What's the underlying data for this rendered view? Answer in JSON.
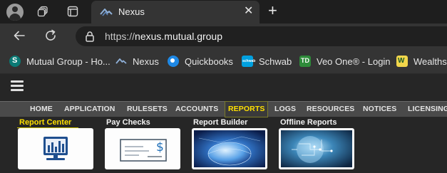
{
  "browser": {
    "active_tab": {
      "title": "Nexus"
    },
    "address": {
      "scheme": "https://",
      "host": "nexus.mutual.group"
    }
  },
  "bookmarks": [
    {
      "label": "Mutual Group - Ho...",
      "icon": "sharepoint-icon"
    },
    {
      "label": "Nexus",
      "icon": "nexus-icon"
    },
    {
      "label": "Quickbooks",
      "icon": "quickbooks-icon"
    },
    {
      "label": "Schwab",
      "icon": "schwab-icon"
    },
    {
      "label": "Veo One® - Login",
      "icon": "td-icon"
    },
    {
      "label": "Wealthsc",
      "icon": "wealthscape-icon"
    }
  ],
  "nav": {
    "items": [
      "HOME",
      "APPLICATION",
      "RULESETS",
      "ACCOUNTS",
      "REPORTS",
      "LOGS",
      "RESOURCES",
      "NOTICES",
      "LICENSING"
    ],
    "active": "REPORTS"
  },
  "reports_menu": [
    {
      "label": "Report Center",
      "icon": "monitor-chart-icon"
    },
    {
      "label": "Pay Checks",
      "icon": "check-icon"
    },
    {
      "label": "Report Builder",
      "icon": "globe-image"
    },
    {
      "label": "Offline Reports",
      "icon": "circuit-globe-image"
    }
  ],
  "colors": {
    "accent_active": "#ffe000",
    "nav_background": "#4a4a4a",
    "page_background": "#262626"
  }
}
